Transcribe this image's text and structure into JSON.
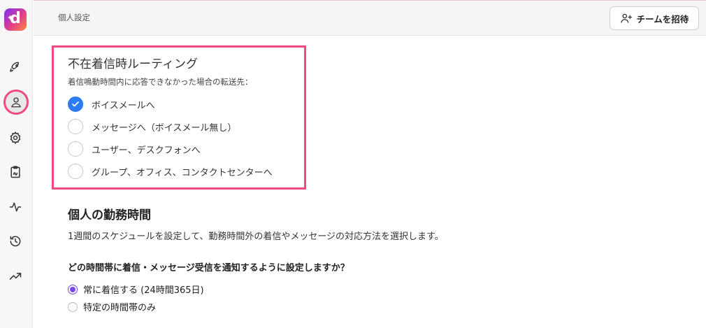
{
  "app": {
    "logo_letter": "d"
  },
  "header": {
    "breadcrumb": "個人設定",
    "invite_label": "チームを招待"
  },
  "routing": {
    "title": "不在着信時ルーティング",
    "description": "着信鳴動時間内に応答できなかった場合の転送先：",
    "options": [
      {
        "label": "ボイスメールへ",
        "checked": true
      },
      {
        "label": "メッセージへ（ボイスメール無し）",
        "checked": false
      },
      {
        "label": "ユーザー、デスクフォンへ",
        "checked": false
      },
      {
        "label": "グループ、オフィス、コンタクトセンターへ",
        "checked": false
      }
    ]
  },
  "hours": {
    "title": "個人の勤務時間",
    "description": "1週間のスケジュールを設定して、勤務時間外の着信やメッセージの対応方法を選択します。",
    "question": "どの時間帯に着信・メッセージ受信を通知するように設定しますか？",
    "options": [
      {
        "label": "常に着信する (24時間365日)",
        "checked": true
      },
      {
        "label": "特定の時間帯のみ",
        "checked": false
      }
    ]
  },
  "colors": {
    "accent_pink": "#ee4a83",
    "check_blue": "#2d7cf6",
    "radio_purple": "#7a49e6"
  },
  "sidebar": {
    "icons": [
      "rocket-icon",
      "person-icon",
      "gear-icon",
      "clipboard-icon",
      "activity-icon",
      "history-icon",
      "trending-icon"
    ]
  }
}
